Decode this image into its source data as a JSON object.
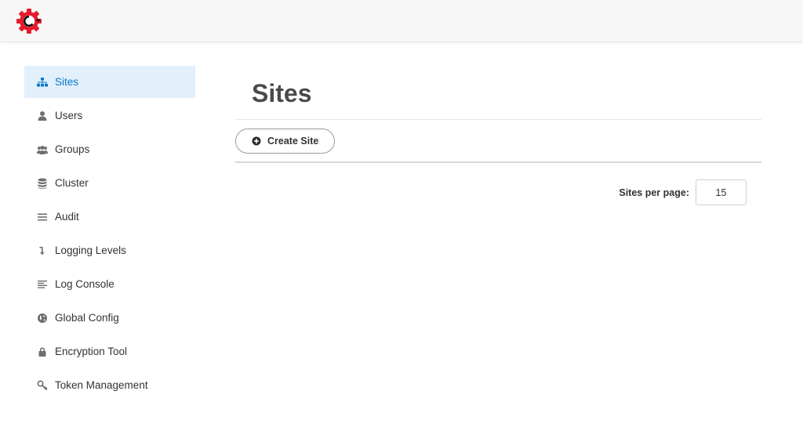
{
  "app": {
    "logo_icon": "cog-c-logo-icon",
    "brand_color": "#e8192c",
    "accent_color": "#0a78c8",
    "active_bg": "#e2f0fc"
  },
  "sidebar": {
    "items": [
      {
        "label": "Sites",
        "icon": "sitemap-icon",
        "active": true
      },
      {
        "label": "Users",
        "icon": "user-icon",
        "active": false
      },
      {
        "label": "Groups",
        "icon": "users-icon",
        "active": false
      },
      {
        "label": "Cluster",
        "icon": "database-icon",
        "active": false
      },
      {
        "label": "Audit",
        "icon": "bars-icon",
        "active": false
      },
      {
        "label": "Logging Levels",
        "icon": "level-down-icon",
        "active": false
      },
      {
        "label": "Log Console",
        "icon": "align-left-icon",
        "active": false
      },
      {
        "label": "Global Config",
        "icon": "globe-icon",
        "active": false
      },
      {
        "label": "Encryption Tool",
        "icon": "lock-icon",
        "active": false
      },
      {
        "label": "Token Management",
        "icon": "key-icon",
        "active": false
      }
    ]
  },
  "main": {
    "title": "Sites",
    "create_button": {
      "label": "Create Site",
      "icon": "plus-circle-icon"
    },
    "per_page": {
      "label": "Sites per page:",
      "value": "15"
    }
  }
}
